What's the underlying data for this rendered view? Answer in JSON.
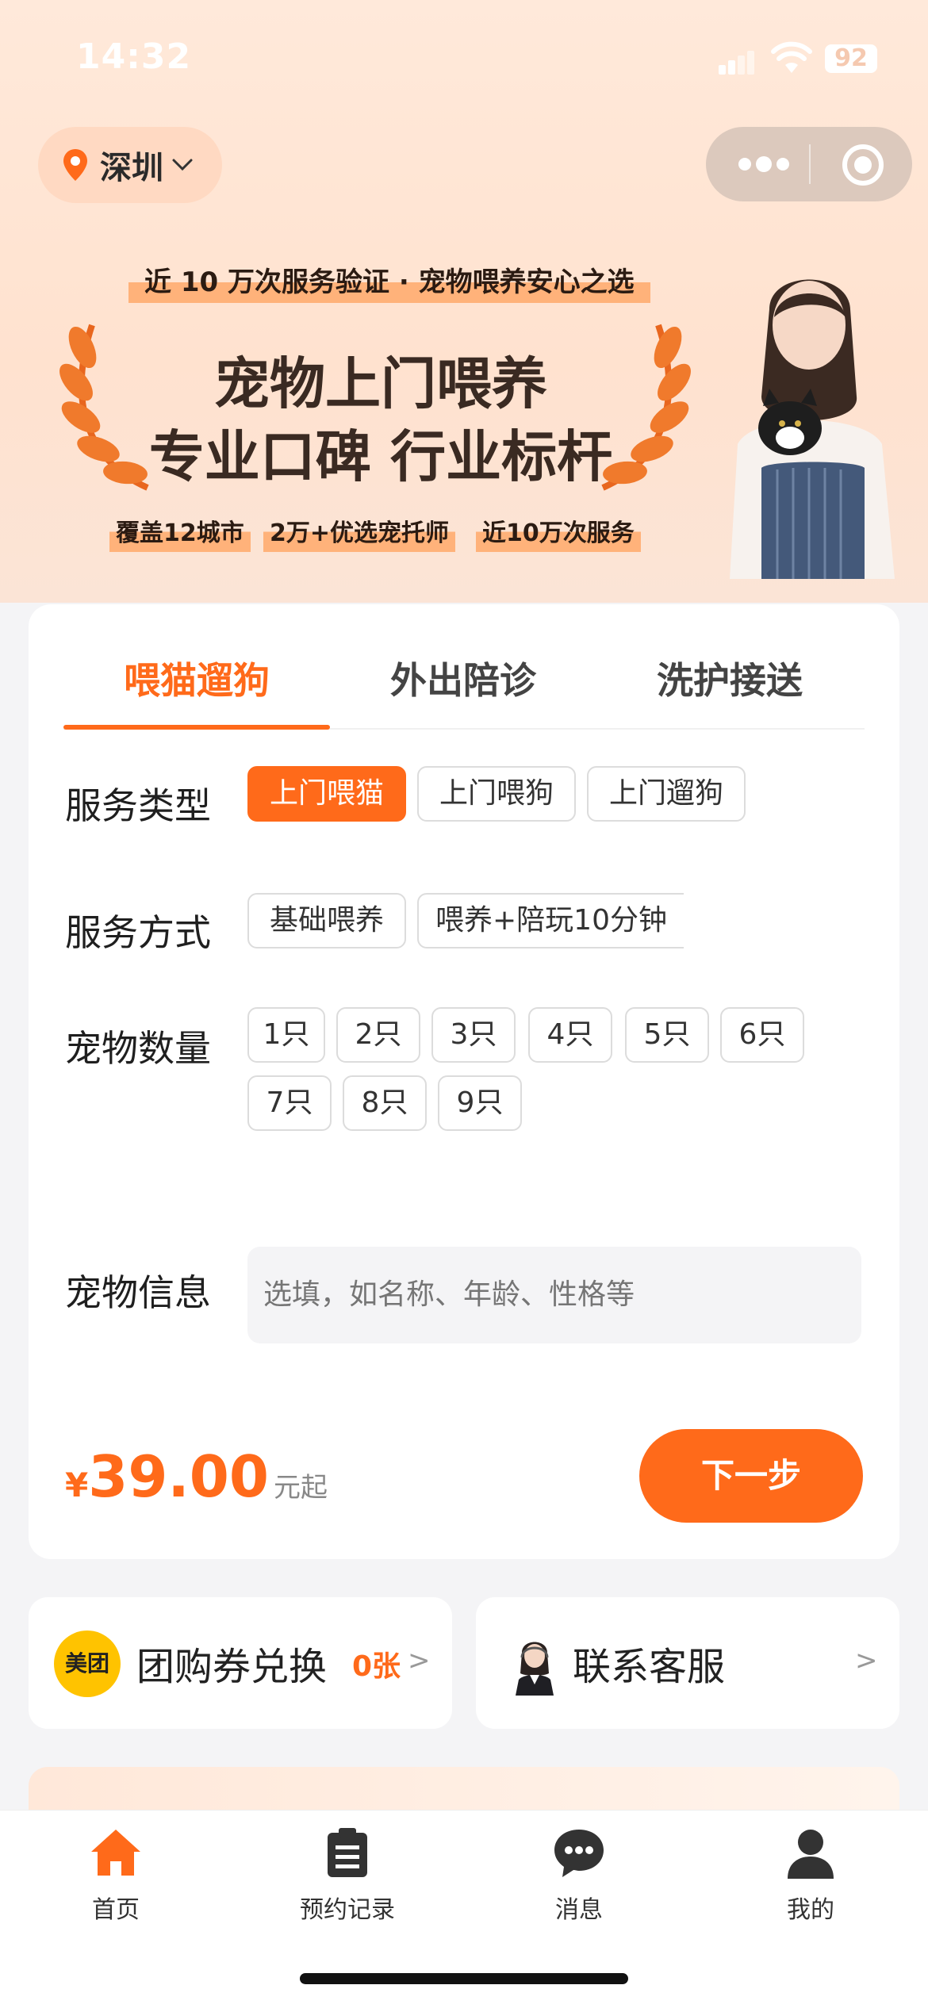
{
  "status_bar": {
    "time": "14:32",
    "battery": "92"
  },
  "location": {
    "city": "深圳",
    "icon": "map-pin-icon"
  },
  "banner": {
    "top_line": "近 10 万次服务验证 · 宠物喂养安心之选",
    "title_1": "宠物上门喂养",
    "title_2": "专业口碑 行业标杆",
    "badges": [
      "覆盖12城市",
      "2万+优选宠托师",
      "近10万次服务"
    ]
  },
  "tabs": [
    {
      "label": "喂猫遛狗",
      "active": true
    },
    {
      "label": "外出陪诊",
      "active": false
    },
    {
      "label": "洗护接送",
      "active": false
    }
  ],
  "form": {
    "service_type_label": "服务类型",
    "service_types": [
      {
        "label": "上门喂猫",
        "selected": true
      },
      {
        "label": "上门喂狗",
        "selected": false
      },
      {
        "label": "上门遛狗",
        "selected": false
      }
    ],
    "service_mode_label": "服务方式",
    "service_modes": [
      {
        "label": "基础喂养",
        "selected": false
      },
      {
        "label": "喂养+陪玩10分钟",
        "selected": false
      }
    ],
    "pet_count_label": "宠物数量",
    "pet_counts": [
      "1只",
      "2只",
      "3只",
      "4只",
      "5只",
      "6只",
      "7只",
      "8只",
      "9只"
    ],
    "pet_info_label": "宠物信息",
    "pet_info_placeholder": "选填，如名称、年龄、性格等"
  },
  "price": {
    "currency": "¥",
    "amount": "39.00",
    "suffix": "元起"
  },
  "next_button": "下一步",
  "coupon": {
    "logo": "美团",
    "title": "团购券兑换",
    "count": "0张",
    "chevron": ">"
  },
  "customer_service": {
    "title": "联系客服",
    "chevron": ">"
  },
  "tabbar": [
    {
      "label": "首页",
      "icon": "home-icon",
      "active": true
    },
    {
      "label": "预约记录",
      "icon": "clipboard-icon",
      "active": false
    },
    {
      "label": "消息",
      "icon": "chat-bubble-icon",
      "active": false
    },
    {
      "label": "我的",
      "icon": "person-icon",
      "active": false
    }
  ],
  "colors": {
    "accent": "#ff6a1a",
    "hero_bg": "#ffe6d4",
    "chip_border": "#dcdcdc"
  }
}
